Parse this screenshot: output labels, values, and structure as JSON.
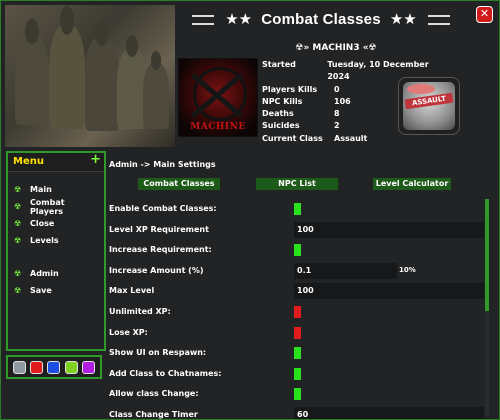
{
  "window": {
    "title": "Combat Classes",
    "title_deco_left": "★★",
    "title_deco_right": "★★",
    "close_glyph": "✕"
  },
  "player": {
    "name": "☢» MACHIN3 «☢",
    "avatar_text": "MACHINE"
  },
  "stats": [
    {
      "label": "Started",
      "value": "Tuesday, 10 December 2024"
    },
    {
      "label": "Players Kills",
      "value": "0"
    },
    {
      "label": "NPC Kills",
      "value": "106"
    },
    {
      "label": "Deaths",
      "value": "8"
    },
    {
      "label": "Suicides",
      "value": "2"
    },
    {
      "label": "Current Class",
      "value": "Assault"
    }
  ],
  "class_icon": {
    "tag": "ASSAULT"
  },
  "menu": {
    "title": "Menu",
    "plus": "+",
    "icon_glyph": "☢",
    "items": [
      {
        "label": "Main"
      },
      {
        "label": "Combat Players"
      },
      {
        "label": "Close"
      },
      {
        "label": "Levels"
      },
      {
        "label": "Admin"
      },
      {
        "label": "Save"
      }
    ]
  },
  "swatches": [
    {
      "name": "gray",
      "color": "#8f9aa3"
    },
    {
      "name": "red",
      "color": "#e01c1c"
    },
    {
      "name": "blue",
      "color": "#1c4fe0"
    },
    {
      "name": "green",
      "color": "#7ed321"
    },
    {
      "name": "purple",
      "color": "#b01ce0"
    }
  ],
  "main": {
    "breadcrumb": "Admin -> Main Settings",
    "tabs": [
      {
        "label": "Combat Classes"
      },
      {
        "label": "NPC List"
      },
      {
        "label": "Level Calculator"
      }
    ]
  },
  "settings": [
    {
      "label": "Enable Combat Classes:",
      "type": "toggle",
      "state": "on"
    },
    {
      "label": "Level XP Requirement",
      "type": "field",
      "value": "100"
    },
    {
      "label": "Increase Requirement:",
      "type": "toggle",
      "state": "on"
    },
    {
      "label": "Increase Amount (%)",
      "type": "field-short",
      "value": "0.1",
      "suffix": "10%"
    },
    {
      "label": "Max Level",
      "type": "field",
      "value": "100"
    },
    {
      "label": "Unlimited XP:",
      "type": "toggle",
      "state": "off"
    },
    {
      "label": "Lose XP:",
      "type": "toggle",
      "state": "off"
    },
    {
      "label": "Show UI on Respawn:",
      "type": "toggle",
      "state": "on"
    },
    {
      "label": "Add Class to Chatnames:",
      "type": "toggle",
      "state": "on"
    },
    {
      "label": "Allow class Change:",
      "type": "toggle",
      "state": "on"
    },
    {
      "label": "Class Change Timer",
      "type": "field",
      "value": "60"
    }
  ],
  "colors": {
    "accent_green": "#2f9a2a",
    "toggle_on": "#28e21c",
    "toggle_off": "#e21c1c",
    "menu_title": "#ffe100",
    "tab_bg": "#1e5a1a",
    "close_red": "#d11b1b"
  }
}
